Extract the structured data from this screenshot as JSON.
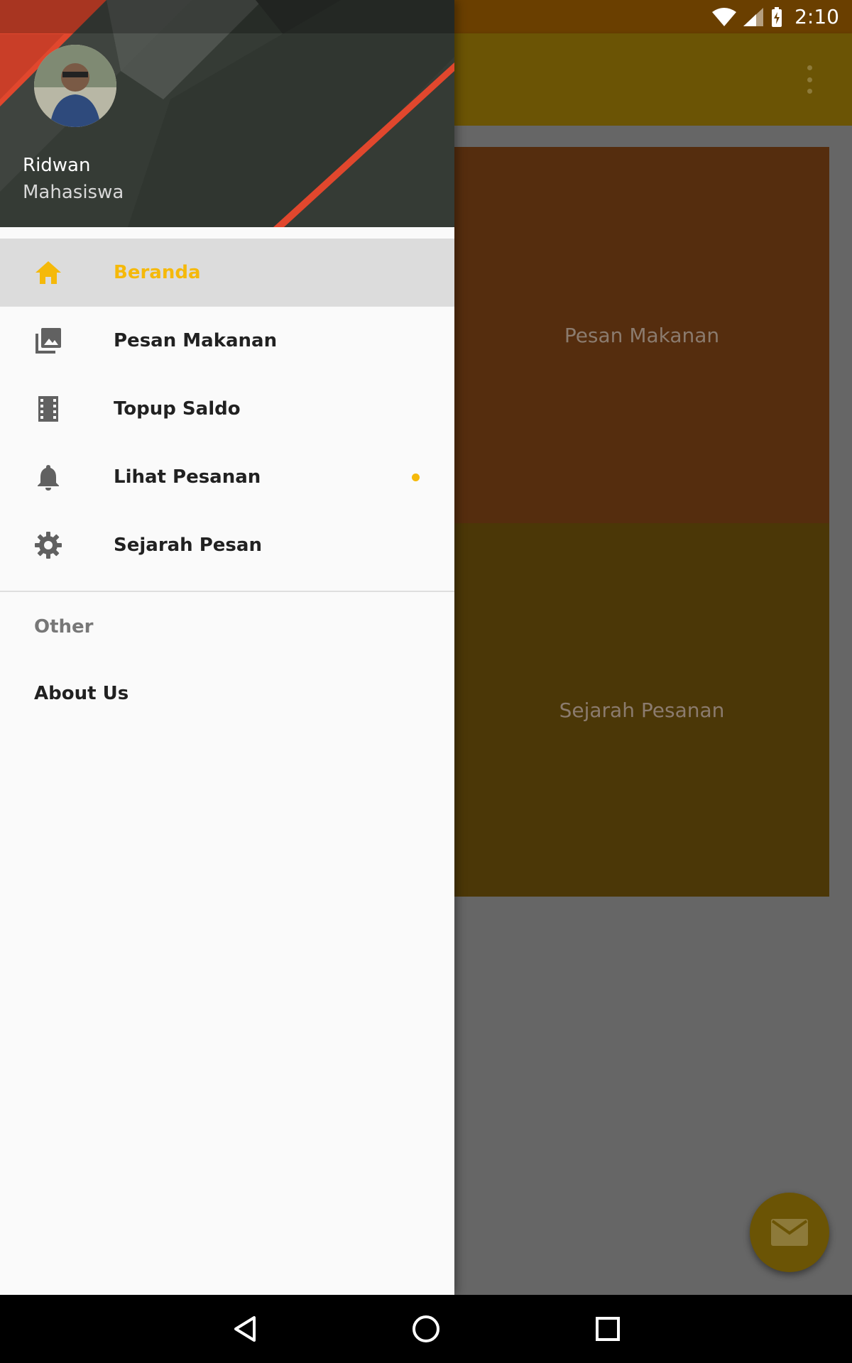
{
  "status_bar": {
    "time": "2:10"
  },
  "app_bar": {
    "menu_icon": "more-vert-icon"
  },
  "cards": [
    {
      "label": "Pesan Makanan"
    },
    {
      "label": "Sejarah Pesanan"
    }
  ],
  "fab": {
    "icon": "mail-icon"
  },
  "drawer": {
    "header": {
      "name": "Ridwan",
      "role": "Mahasiswa"
    },
    "items": [
      {
        "label": "Beranda",
        "icon": "home-icon",
        "active": true
      },
      {
        "label": "Pesan Makanan",
        "icon": "photo-library-icon"
      },
      {
        "label": "Topup Saldo",
        "icon": "film-icon"
      },
      {
        "label": "Lihat Pesanan",
        "icon": "bell-icon"
      },
      {
        "label": "Sejarah Pesan",
        "icon": "gear-icon"
      }
    ],
    "section": {
      "title": "Other",
      "items": [
        {
          "label": "About Us"
        }
      ]
    }
  },
  "colors": {
    "accent": "#f5b90a",
    "primary_dimmed": "#6b5405",
    "status_dimmed": "#6a3f00"
  }
}
